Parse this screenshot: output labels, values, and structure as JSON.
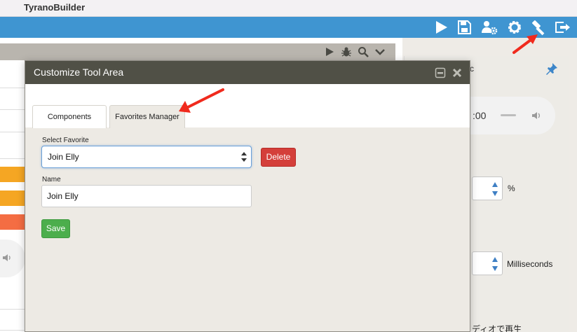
{
  "app": {
    "title": "TyranoBuilder"
  },
  "toolbar": {
    "icons": [
      "play-icon",
      "save-icon",
      "users-settings-icon",
      "gear-icon",
      "hammer-icon",
      "exit-icon"
    ]
  },
  "editor_header": {
    "icons": [
      "play-icon",
      "bug-icon",
      "search-icon",
      "chevron-down-icon"
    ]
  },
  "right_panel": {
    "clip_text": "c",
    "time": ":00",
    "percent_unit": "%",
    "ms_unit": "Milliseconds",
    "japanese_text": "ディオで再生"
  },
  "dialog": {
    "title": "Customize Tool Area",
    "tabs": [
      {
        "label": "Components",
        "active": false
      },
      {
        "label": "Favorites Manager",
        "active": true
      }
    ],
    "select_favorite_label": "Select Favorite",
    "select_value": "Join Elly",
    "delete_label": "Delete",
    "name_label": "Name",
    "name_value": "Join Elly",
    "save_label": "Save"
  },
  "colors": {
    "toolbar": "#3f95d1",
    "dialog_title": "#505046",
    "delete": "#d43f3a",
    "save": "#4cae4c",
    "annotation_arrow": "#f02a1d"
  }
}
